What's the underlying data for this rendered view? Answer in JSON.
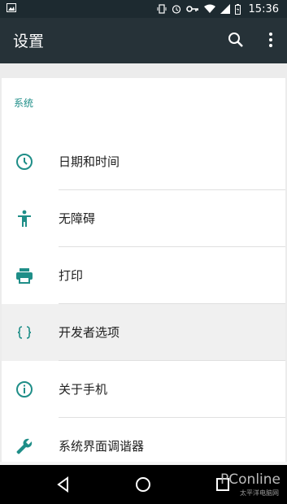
{
  "status_bar": {
    "time": "15:36",
    "icons": [
      "image-icon",
      "vibrate-icon",
      "alarm-icon",
      "key-icon",
      "wifi-icon",
      "signal-icon",
      "battery-icon"
    ]
  },
  "app_bar": {
    "title": "设置",
    "icons": [
      "search-icon",
      "more-icon"
    ]
  },
  "section": {
    "title": "系统",
    "items": [
      {
        "label": "日期和时间",
        "icon": "clock-icon"
      },
      {
        "label": "无障碍",
        "icon": "accessibility-icon"
      },
      {
        "label": "打印",
        "icon": "printer-icon"
      },
      {
        "label": "开发者选项",
        "icon": "braces-icon"
      },
      {
        "label": "关于手机",
        "icon": "info-icon"
      },
      {
        "label": "系统界面调谐器",
        "icon": "wrench-icon"
      }
    ]
  },
  "nav_bar": {
    "icons": [
      "back-icon",
      "home-icon",
      "recents-icon"
    ]
  },
  "watermark": {
    "brand": "PConline",
    "sub": "太平洋电脑网"
  },
  "colors": {
    "accent": "#1f8e88",
    "appbar": "#263238",
    "statusbar": "#1d2a30"
  }
}
